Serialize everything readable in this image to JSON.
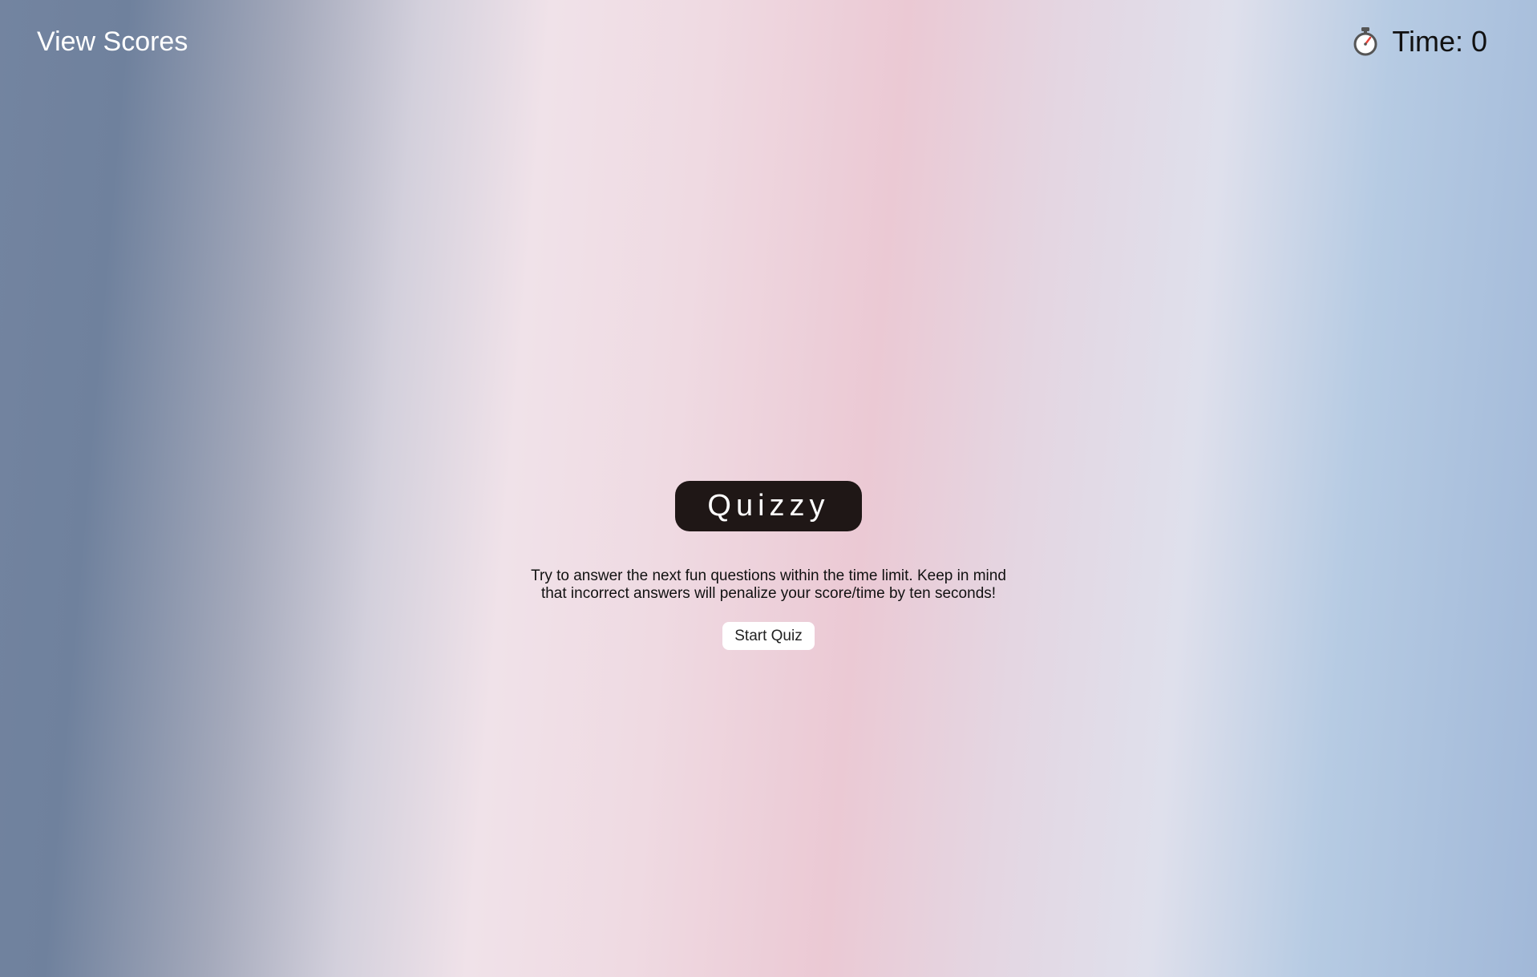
{
  "header": {
    "view_scores_label": "View Scores",
    "timer": {
      "icon": "stopwatch-icon",
      "label": "Time: 0"
    }
  },
  "main": {
    "title": "Quizzy",
    "description": "Try to answer the next fun questions within the time limit. Keep in mind that incorrect answers will penalize your score/time by ten seconds!",
    "start_button_label": "Start Quiz"
  },
  "colors": {
    "title_background": "#1f1716",
    "button_background": "#ffffff",
    "stopwatch_hand": "#e8453c"
  }
}
